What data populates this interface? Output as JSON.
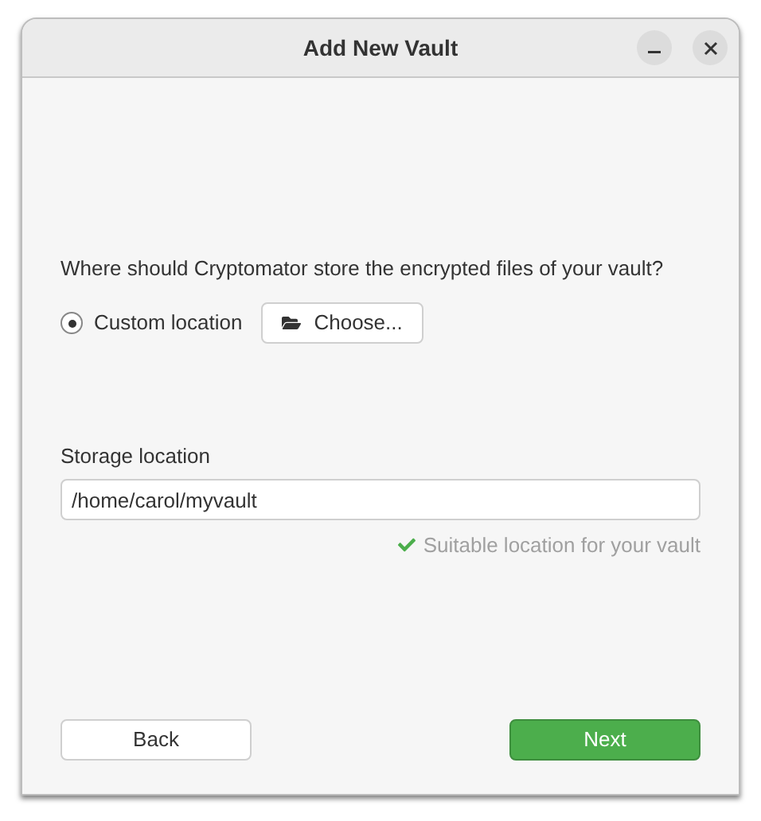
{
  "window": {
    "title": "Add New Vault",
    "controls": [
      {
        "kind": "minimize"
      },
      {
        "kind": "close"
      }
    ]
  },
  "question": "Where should Cryptomator store the encrypted files of your vault?",
  "location_option": {
    "label": "Custom location",
    "selected": true
  },
  "choose_button": {
    "label": "Choose..."
  },
  "storage": {
    "label": "Storage location",
    "value": "/home/carol/myvault",
    "validation": "Suitable location for your vault",
    "valid": true
  },
  "buttons": [
    {
      "label": "Back",
      "kind": "secondary"
    },
    {
      "label": "Next",
      "kind": "primary"
    }
  ]
}
